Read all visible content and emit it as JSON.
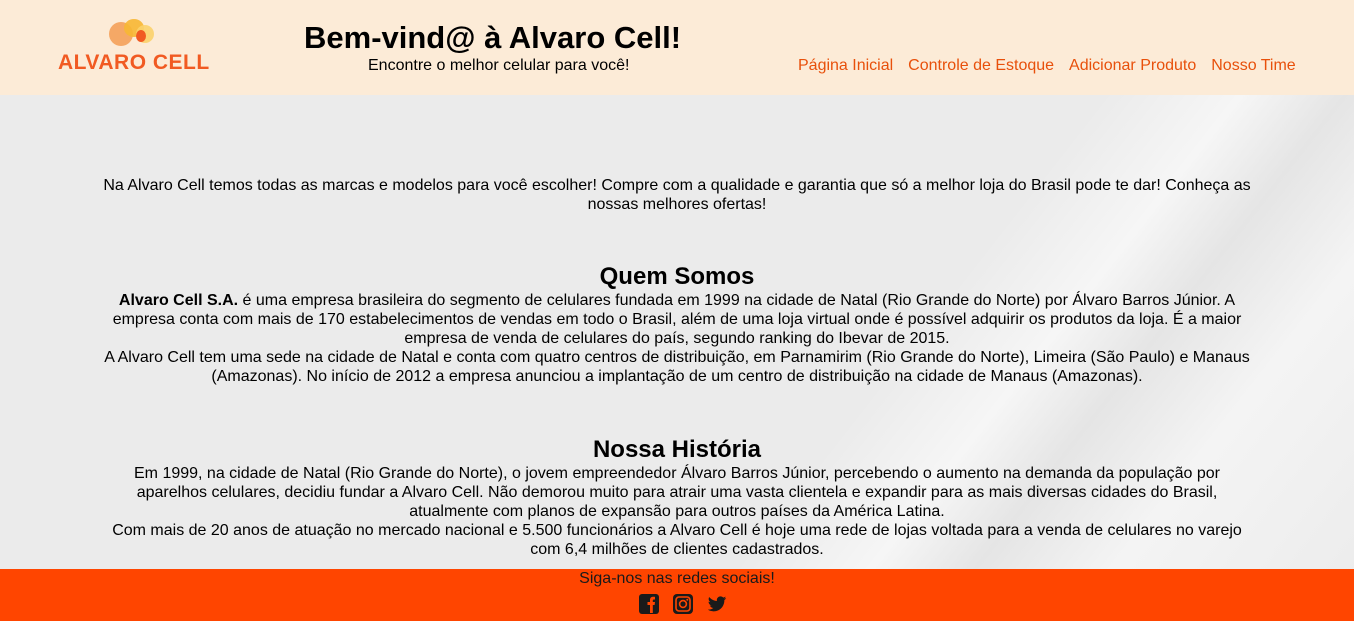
{
  "header": {
    "logo_text": "ALVARO CELL",
    "title": "Bem-vind@ à Alvaro Cell!",
    "subtitle": "Encontre o melhor celular para você!"
  },
  "nav": {
    "items": [
      {
        "label": "Página Inicial"
      },
      {
        "label": "Controle de Estoque"
      },
      {
        "label": "Adicionar Produto"
      },
      {
        "label": "Nosso Time"
      }
    ]
  },
  "main": {
    "intro": "Na Alvaro Cell temos todas as marcas e modelos para você escolher! Compre com a qualidade e garantia que só a melhor loja do Brasil pode te dar! Conheça as nossas melhores ofertas!",
    "quem_somos": {
      "title": "Quem Somos",
      "company": "Alvaro Cell S.A.",
      "p1": " é uma empresa brasileira do segmento de celulares fundada em 1999 na cidade de Natal (Rio Grande do Norte) por Álvaro Barros Júnior. A empresa conta com mais de 170 estabelecimentos de vendas em todo o Brasil, além de uma loja virtual onde é possível adquirir os produtos da loja. É a maior empresa de venda de celulares do país, segundo ranking do Ibevar de 2015.",
      "p2": "A Alvaro Cell tem uma sede na cidade de Natal e conta com quatro centros de distribuição, em Parnamirim (Rio Grande do Norte), Limeira (São Paulo) e Manaus (Amazonas). No início de 2012 a empresa anunciou a implantação de um centro de distribuição na cidade de Manaus (Amazonas)."
    },
    "historia": {
      "title": "Nossa História",
      "p1": "Em 1999, na cidade de Natal (Rio Grande do Norte), o jovem empreendedor Álvaro Barros Júnior, percebendo o aumento na demanda da população por aparelhos celulares, decidiu fundar a Alvaro Cell. Não demorou muito para atrair uma vasta clientela e expandir para as mais diversas cidades do Brasil, atualmente com planos de expansão para outros países da América Latina.",
      "p2": "Com mais de 20 anos de atuação no mercado nacional e 5.500 funcionários a Alvaro Cell é hoje uma rede de lojas voltada para a venda de celulares no varejo com 6,4 milhões de clientes cadastrados."
    }
  },
  "footer": {
    "text": "Siga-nos nas redes sociais!",
    "icons": [
      "facebook-icon",
      "instagram-icon",
      "twitter-icon"
    ]
  },
  "colors": {
    "header_bg": "#fcebd7",
    "accent": "#f15a22",
    "nav_link": "#e8500b",
    "footer_bg": "#ff4500",
    "page_bg": "#ebebeb"
  }
}
